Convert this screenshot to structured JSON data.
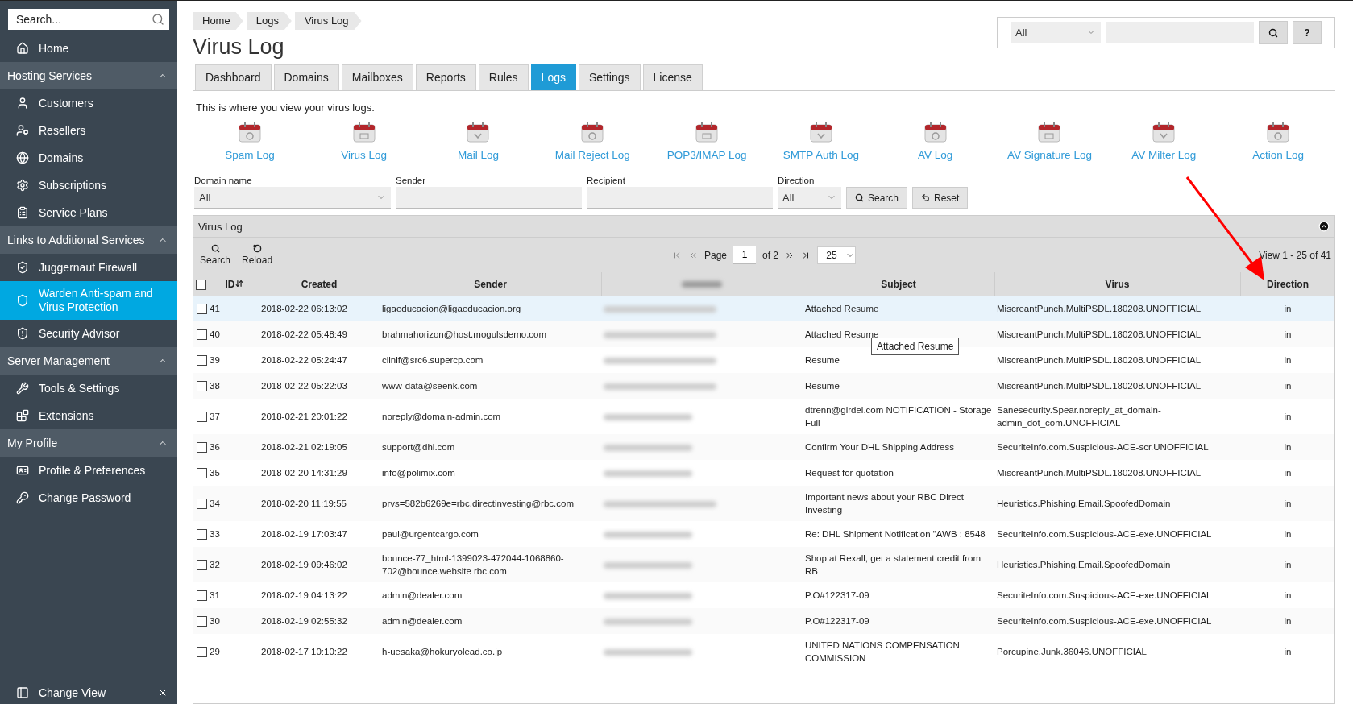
{
  "sidebar": {
    "search_placeholder": "Search...",
    "home": {
      "label": "Home",
      "selected": false
    },
    "sections": [
      {
        "title": "Hosting Services",
        "expanded": true,
        "items": [
          {
            "label": "Customers",
            "selected": false
          },
          {
            "label": "Resellers",
            "selected": false
          },
          {
            "label": "Domains",
            "selected": false
          },
          {
            "label": "Subscriptions",
            "selected": false
          },
          {
            "label": "Service Plans",
            "selected": false
          }
        ]
      },
      {
        "title": "Links to Additional Services",
        "expanded": true,
        "items": [
          {
            "label": "Juggernaut Firewall",
            "selected": false
          },
          {
            "label": "Warden Anti-spam and Virus Protection",
            "selected": true
          },
          {
            "label": "Security Advisor",
            "selected": false
          }
        ]
      },
      {
        "title": "Server Management",
        "expanded": true,
        "items": [
          {
            "label": "Tools & Settings",
            "selected": false
          },
          {
            "label": "Extensions",
            "selected": false
          }
        ]
      },
      {
        "title": "My Profile",
        "expanded": true,
        "items": [
          {
            "label": "Profile & Preferences",
            "selected": false
          },
          {
            "label": "Change Password",
            "selected": false
          }
        ]
      }
    ],
    "footer": "Change View"
  },
  "breadcrumbs": [
    "Home",
    "Logs",
    "Virus Log"
  ],
  "title": "Virus Log",
  "top_search": {
    "scope": "All",
    "help": "?"
  },
  "tabs": [
    {
      "label": "Dashboard",
      "selected": false
    },
    {
      "label": "Domains",
      "selected": false
    },
    {
      "label": "Mailboxes",
      "selected": false
    },
    {
      "label": "Reports",
      "selected": false
    },
    {
      "label": "Rules",
      "selected": false
    },
    {
      "label": "Logs",
      "selected": true
    },
    {
      "label": "Settings",
      "selected": false
    },
    {
      "label": "License",
      "selected": false
    }
  ],
  "description": "This is where you view your virus logs.",
  "log_links": [
    "Spam Log",
    "Virus Log",
    "Mail Log",
    "Mail Reject Log",
    "POP3/IMAP Log",
    "SMTP Auth Log",
    "AV Log",
    "AV Signature Log",
    "AV Milter Log",
    "Action Log"
  ],
  "filters": {
    "domain": {
      "label": "Domain name",
      "value": "All"
    },
    "sender": {
      "label": "Sender"
    },
    "recipient": {
      "label": "Recipient"
    },
    "direction": {
      "label": "Direction",
      "value": "All"
    },
    "buttons": [
      "Search",
      "Reset"
    ]
  },
  "grid": {
    "title": "Virus Log",
    "toolbar": [
      "Search",
      "Reload"
    ],
    "pager": {
      "page_label": "Page",
      "page": "1",
      "of": "of 2",
      "page_size": "25",
      "view": "View 1 - 25 of 41"
    },
    "select_all": false,
    "columns": [
      {
        "kind": "text",
        "label": "ID",
        "sorted": true
      },
      {
        "kind": "text",
        "label": "Created",
        "sorted": false
      },
      {
        "kind": "text",
        "label": "Sender",
        "sorted": false
      },
      {
        "kind": "redacted",
        "sorted": false
      },
      {
        "kind": "text",
        "label": "Subject",
        "sorted": false
      },
      {
        "kind": "text",
        "label": "Virus",
        "sorted": false
      },
      {
        "kind": "text",
        "label": "Direction",
        "sorted": false
      }
    ],
    "rows": [
      {
        "checked": false,
        "selected": true,
        "cells": [
          "41",
          "2018-02-22 06:13:02",
          "ligaeducacion@ligaeducacion.org",
          "",
          "Attached Resume",
          "MiscreantPunch.MultiPSDL.180208.UNOFFICIAL",
          "in"
        ]
      },
      {
        "checked": false,
        "selected": false,
        "tooltip": "Attached Resume",
        "cells": [
          "40",
          "2018-02-22 05:48:49",
          "brahmahorizon@host.mogulsdemo.com",
          "",
          "Attached Resume",
          "MiscreantPunch.MultiPSDL.180208.UNOFFICIAL",
          "in"
        ]
      },
      {
        "checked": false,
        "selected": false,
        "cells": [
          "39",
          "2018-02-22 05:24:47",
          "clinif@src6.supercp.com",
          "",
          "Resume",
          "MiscreantPunch.MultiPSDL.180208.UNOFFICIAL",
          "in"
        ]
      },
      {
        "checked": false,
        "selected": false,
        "cells": [
          "38",
          "2018-02-22 05:22:03",
          "www-data@seenk.com",
          "",
          "Resume",
          "MiscreantPunch.MultiPSDL.180208.UNOFFICIAL",
          "in"
        ]
      },
      {
        "checked": false,
        "selected": false,
        "cells": [
          "37",
          "2018-02-21 20:01:22",
          "noreply@domain-admin.com",
          "",
          "dtrenn@girdel.com NOTIFICATION - Storage Full",
          "Sanesecurity.Spear.noreply_at_domain-admin_dot_com.UNOFFICIAL",
          "in"
        ]
      },
      {
        "checked": false,
        "selected": false,
        "cells": [
          "36",
          "2018-02-21 02:19:05",
          "support@dhl.com",
          "",
          "Confirm Your DHL Shipping Address",
          "SecuriteInfo.com.Suspicious-ACE-scr.UNOFFICIAL",
          "in"
        ]
      },
      {
        "checked": false,
        "selected": false,
        "cells": [
          "35",
          "2018-02-20 14:31:29",
          "info@polimix.com",
          "",
          "Request for quotation",
          "MiscreantPunch.MultiPSDL.180208.UNOFFICIAL",
          "in"
        ]
      },
      {
        "checked": false,
        "selected": false,
        "cells": [
          "34",
          "2018-02-20 11:19:55",
          "prvs=582b6269e=rbc.directinvesting@rbc.com",
          "",
          "Important news about your RBC Direct Investing",
          "Heuristics.Phishing.Email.SpoofedDomain",
          "in"
        ]
      },
      {
        "checked": false,
        "selected": false,
        "cells": [
          "33",
          "2018-02-19 17:03:47",
          "paul@urgentcargo.com",
          "",
          "Re: DHL Shipment Notification \"AWB : 8548",
          "SecuriteInfo.com.Suspicious-ACE-exe.UNOFFICIAL",
          "in"
        ]
      },
      {
        "checked": false,
        "selected": false,
        "cells": [
          "32",
          "2018-02-19 09:46:02",
          "bounce-77_html-1399023-472044-1068860-702@bounce.website rbc.com",
          "",
          "Shop at Rexall, get a statement credit from RB",
          "Heuristics.Phishing.Email.SpoofedDomain",
          "in"
        ]
      },
      {
        "checked": false,
        "selected": false,
        "cells": [
          "31",
          "2018-02-19 04:13:22",
          "admin@dealer.com",
          "",
          "P.O#122317-09",
          "SecuriteInfo.com.Suspicious-ACE-exe.UNOFFICIAL",
          "in"
        ]
      },
      {
        "checked": false,
        "selected": false,
        "cells": [
          "30",
          "2018-02-19 02:55:32",
          "admin@dealer.com",
          "",
          "P.O#122317-09",
          "SecuriteInfo.com.Suspicious-ACE-exe.UNOFFICIAL",
          "in"
        ]
      },
      {
        "checked": false,
        "selected": false,
        "cells": [
          "29",
          "2018-02-17 10:10:22",
          "h-uesaka@hokuryolead.co.jp",
          "",
          "UNITED NATIONS COMPENSATION COMMISSION",
          "Porcupine.Junk.36046.UNOFFICIAL",
          "in"
        ]
      }
    ]
  },
  "callout_arrow": true
}
